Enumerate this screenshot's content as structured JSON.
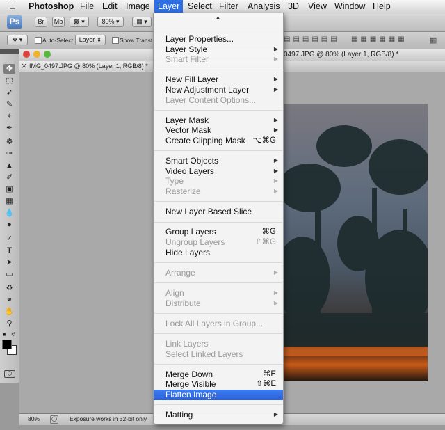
{
  "menubar": {
    "apple_icon": "apple-icon",
    "app_name": "Photoshop",
    "items": [
      "File",
      "Edit",
      "Image",
      "Layer",
      "Select",
      "Filter",
      "Analysis",
      "3D",
      "View",
      "Window",
      "Help"
    ],
    "active": "Layer"
  },
  "options_bar": {
    "zoom": "80%",
    "auto_select_label": "Auto-Select",
    "auto_select_value": "Layer",
    "show_transform_label": "Show Transform"
  },
  "document": {
    "window_title": "0497.JPG @ 80% (Layer 1, RGB/8) *",
    "tab_title": "IMG_0497.JPG @ 80% (Layer 1, RGB/8) *"
  },
  "status": {
    "zoom": "80%",
    "message": "Exposure works in 32-bit only"
  },
  "menu": {
    "groups": [
      [
        {
          "label": "Layer Properties...",
          "enabled": true
        },
        {
          "label": "Layer Style",
          "enabled": true,
          "submenu": true
        },
        {
          "label": "Smart Filter",
          "enabled": false,
          "submenu": true
        }
      ],
      [
        {
          "label": "New Fill Layer",
          "enabled": true,
          "submenu": true
        },
        {
          "label": "New Adjustment Layer",
          "enabled": true,
          "submenu": true
        },
        {
          "label": "Layer Content Options...",
          "enabled": false
        }
      ],
      [
        {
          "label": "Layer Mask",
          "enabled": true,
          "submenu": true
        },
        {
          "label": "Vector Mask",
          "enabled": true,
          "submenu": true
        },
        {
          "label": "Create Clipping Mask",
          "enabled": true,
          "shortcut": "⌥⌘G"
        }
      ],
      [
        {
          "label": "Smart Objects",
          "enabled": true,
          "submenu": true
        },
        {
          "label": "Video Layers",
          "enabled": true,
          "submenu": true
        },
        {
          "label": "Type",
          "enabled": false,
          "submenu": true
        },
        {
          "label": "Rasterize",
          "enabled": false,
          "submenu": true
        }
      ],
      [
        {
          "label": "New Layer Based Slice",
          "enabled": true
        }
      ],
      [
        {
          "label": "Group Layers",
          "enabled": true,
          "shortcut": "⌘G"
        },
        {
          "label": "Ungroup Layers",
          "enabled": false,
          "shortcut": "⇧⌘G"
        },
        {
          "label": "Hide Layers",
          "enabled": true
        }
      ],
      [
        {
          "label": "Arrange",
          "enabled": false,
          "submenu": true
        }
      ],
      [
        {
          "label": "Align",
          "enabled": false,
          "submenu": true
        },
        {
          "label": "Distribute",
          "enabled": false,
          "submenu": true
        }
      ],
      [
        {
          "label": "Lock All Layers in Group...",
          "enabled": false
        }
      ],
      [
        {
          "label": "Link Layers",
          "enabled": false
        },
        {
          "label": "Select Linked Layers",
          "enabled": false
        }
      ],
      [
        {
          "label": "Merge Down",
          "enabled": true,
          "shortcut": "⌘E"
        },
        {
          "label": "Merge Visible",
          "enabled": true,
          "shortcut": "⇧⌘E"
        },
        {
          "label": "Flatten Image",
          "enabled": true,
          "highlighted": true
        }
      ],
      [
        {
          "label": "Matting",
          "enabled": true,
          "submenu": true
        }
      ]
    ]
  },
  "colors": {
    "menu_highlight": "#2f6fe4",
    "disabled_text": "#9a9a9a"
  }
}
